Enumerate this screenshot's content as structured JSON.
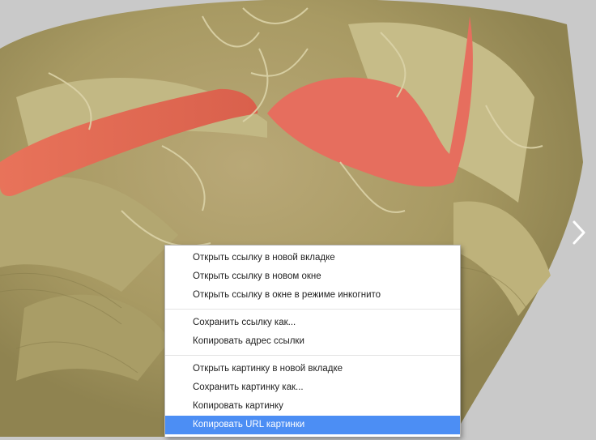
{
  "viewer": {
    "background_color": "#c9c9c9",
    "image_subject": "micrograph-image",
    "next_icon": "chevron-right-icon"
  },
  "context_menu": {
    "groups": [
      {
        "items": [
          {
            "label": "Открыть ссылку в новой вкладке"
          },
          {
            "label": "Открыть ссылку в новом окне"
          },
          {
            "label": "Открыть ссылку в окне в режиме инкогнито"
          }
        ]
      },
      {
        "items": [
          {
            "label": "Сохранить ссылку как..."
          },
          {
            "label": "Копировать адрес ссылки"
          }
        ]
      },
      {
        "items": [
          {
            "label": "Открыть картинку в новой вкладке"
          },
          {
            "label": "Сохранить картинку как..."
          },
          {
            "label": "Копировать картинку"
          },
          {
            "label": "Копировать URL картинки",
            "highlighted": true
          }
        ]
      }
    ],
    "highlight_color": "#4c8ef4"
  }
}
